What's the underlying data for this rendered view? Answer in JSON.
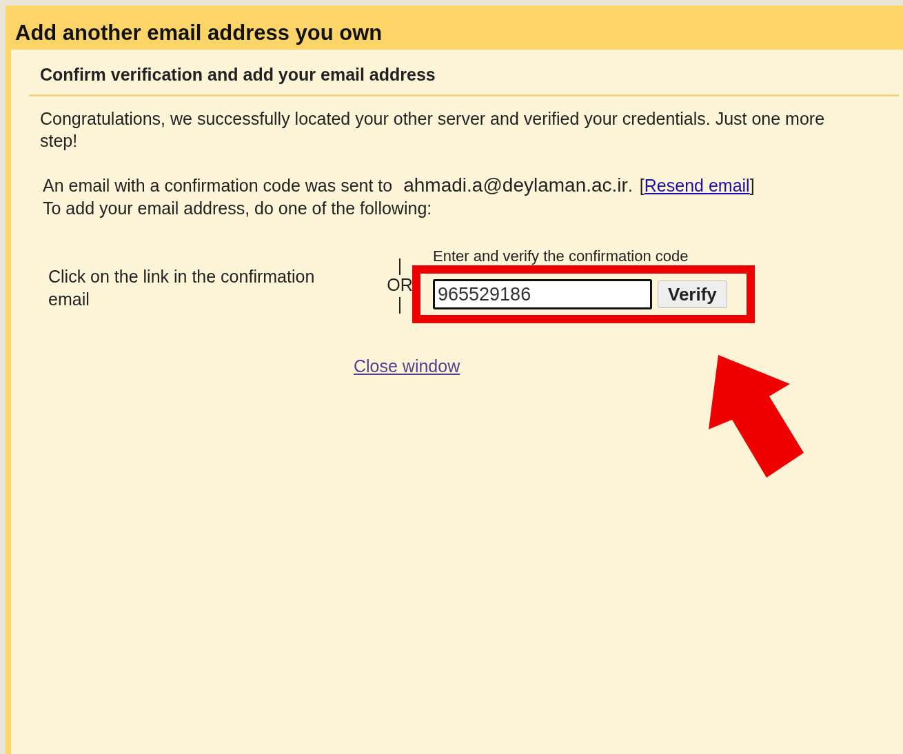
{
  "window": {
    "title": "Add another email address you own"
  },
  "section": {
    "heading": "Confirm verification and add your email address"
  },
  "message": "Congratulations, we successfully located your other server and verified your credentials. Just one more step!",
  "sent_notice": {
    "prefix": "An email with a confirmation code was sent to",
    "email": "ahmadi.a@deylaman.ac.ir",
    "after_email": ".",
    "bracket_open": "[",
    "resend_link": "Resend email",
    "bracket_close": "]"
  },
  "instruction": "To add your email address, do one of the following:",
  "option_link": "Click on the link in the confirmation email",
  "divider": {
    "top": "|",
    "label": "OR",
    "bottom": "|"
  },
  "option_code": {
    "label": "Enter and verify the confirmation code",
    "value": "965529186",
    "button": "Verify"
  },
  "close_link": "Close window"
}
